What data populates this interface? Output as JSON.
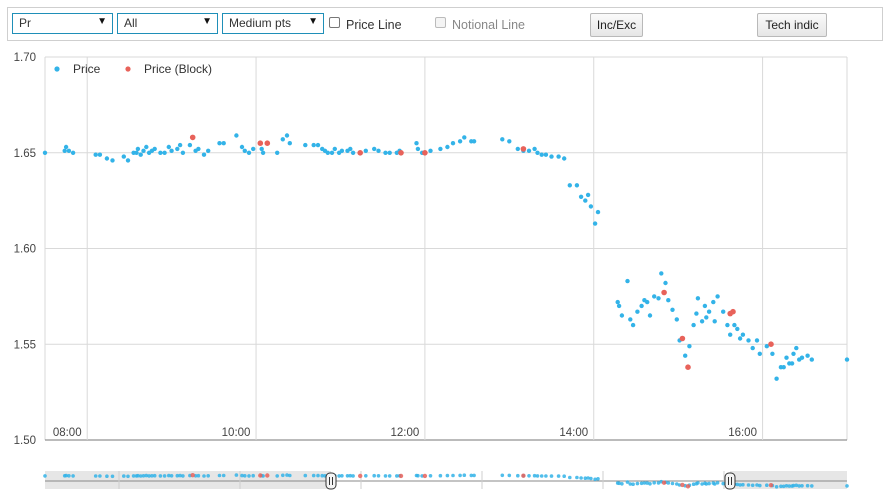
{
  "toolbar": {
    "field_select": "Pr",
    "filter_select": "All",
    "points_select": "Medium pts",
    "price_line_label": "Price Line",
    "notional_line_label": "Notional Line",
    "inc_exc_label": "Inc/Exc",
    "tech_indic_label": "Tech indic"
  },
  "colors": {
    "price": "#33b3e8",
    "block": "#e8625a",
    "grid": "#d9d9d9",
    "navigator_fill": "#e6e6e6"
  },
  "chart_data": {
    "type": "scatter",
    "x_unit": "time of day",
    "xlim": [
      "07:30",
      "17:00"
    ],
    "ylim": [
      1.5,
      1.7
    ],
    "x_ticks": [
      "08:00",
      "10:00",
      "12:00",
      "14:00",
      "16:00"
    ],
    "y_ticks": [
      "1.50",
      "1.55",
      "1.60",
      "1.65",
      "1.70"
    ],
    "grid": true,
    "legend_position": "top-left",
    "series": [
      {
        "name": "Price",
        "color": "#33b3e8",
        "points": [
          [
            "07:30",
            1.65
          ],
          [
            "07:44",
            1.651
          ],
          [
            "07:45",
            1.653
          ],
          [
            "07:47",
            1.651
          ],
          [
            "07:50",
            1.65
          ],
          [
            "08:06",
            1.649
          ],
          [
            "08:09",
            1.649
          ],
          [
            "08:14",
            1.647
          ],
          [
            "08:18",
            1.646
          ],
          [
            "08:26",
            1.648
          ],
          [
            "08:29",
            1.646
          ],
          [
            "08:33",
            1.65
          ],
          [
            "08:35",
            1.65
          ],
          [
            "08:36",
            1.652
          ],
          [
            "08:38",
            1.649
          ],
          [
            "08:40",
            1.651
          ],
          [
            "08:42",
            1.653
          ],
          [
            "08:44",
            1.65
          ],
          [
            "08:46",
            1.651
          ],
          [
            "08:48",
            1.652
          ],
          [
            "08:52",
            1.65
          ],
          [
            "08:55",
            1.65
          ],
          [
            "08:58",
            1.653
          ],
          [
            "09:00",
            1.651
          ],
          [
            "09:04",
            1.652
          ],
          [
            "09:06",
            1.654
          ],
          [
            "09:08",
            1.65
          ],
          [
            "09:13",
            1.654
          ],
          [
            "09:17",
            1.651
          ],
          [
            "09:19",
            1.652
          ],
          [
            "09:23",
            1.649
          ],
          [
            "09:26",
            1.651
          ],
          [
            "09:34",
            1.655
          ],
          [
            "09:37",
            1.655
          ],
          [
            "09:46",
            1.659
          ],
          [
            "09:50",
            1.653
          ],
          [
            "09:52",
            1.651
          ],
          [
            "09:55",
            1.65
          ],
          [
            "09:58",
            1.652
          ],
          [
            "10:04",
            1.652
          ],
          [
            "10:05",
            1.65
          ],
          [
            "10:15",
            1.65
          ],
          [
            "10:19",
            1.657
          ],
          [
            "10:22",
            1.659
          ],
          [
            "10:24",
            1.655
          ],
          [
            "10:35",
            1.654
          ],
          [
            "10:41",
            1.654
          ],
          [
            "10:44",
            1.654
          ],
          [
            "10:47",
            1.652
          ],
          [
            "10:49",
            1.651
          ],
          [
            "10:51",
            1.65
          ],
          [
            "10:54",
            1.65
          ],
          [
            "10:56",
            1.652
          ],
          [
            "10:59",
            1.65
          ],
          [
            "11:01",
            1.651
          ],
          [
            "11:05",
            1.651
          ],
          [
            "11:07",
            1.652
          ],
          [
            "11:09",
            1.65
          ],
          [
            "11:18",
            1.651
          ],
          [
            "11:24",
            1.652
          ],
          [
            "11:27",
            1.651
          ],
          [
            "11:32",
            1.65
          ],
          [
            "11:35",
            1.65
          ],
          [
            "11:40",
            1.65
          ],
          [
            "11:42",
            1.651
          ],
          [
            "11:54",
            1.655
          ],
          [
            "11:55",
            1.652
          ],
          [
            "11:58",
            1.65
          ],
          [
            "12:04",
            1.651
          ],
          [
            "12:11",
            1.652
          ],
          [
            "12:16",
            1.653
          ],
          [
            "12:20",
            1.655
          ],
          [
            "12:25",
            1.656
          ],
          [
            "12:28",
            1.658
          ],
          [
            "12:33",
            1.656
          ],
          [
            "12:35",
            1.656
          ],
          [
            "12:55",
            1.657
          ],
          [
            "13:00",
            1.656
          ],
          [
            "13:06",
            1.652
          ],
          [
            "13:10",
            1.651
          ],
          [
            "13:14",
            1.651
          ],
          [
            "13:18",
            1.652
          ],
          [
            "13:20",
            1.65
          ],
          [
            "13:23",
            1.649
          ],
          [
            "13:26",
            1.649
          ],
          [
            "13:30",
            1.648
          ],
          [
            "13:35",
            1.648
          ],
          [
            "13:39",
            1.647
          ],
          [
            "13:43",
            1.633
          ],
          [
            "13:48",
            1.633
          ],
          [
            "13:51",
            1.627
          ],
          [
            "13:54",
            1.625
          ],
          [
            "13:56",
            1.628
          ],
          [
            "13:58",
            1.622
          ],
          [
            "14:01",
            1.613
          ],
          [
            "14:03",
            1.619
          ],
          [
            "14:17",
            1.572
          ],
          [
            "14:18",
            1.57
          ],
          [
            "14:20",
            1.565
          ],
          [
            "14:24",
            1.583
          ],
          [
            "14:26",
            1.563
          ],
          [
            "14:28",
            1.56
          ],
          [
            "14:31",
            1.567
          ],
          [
            "14:34",
            1.57
          ],
          [
            "14:36",
            1.573
          ],
          [
            "14:38",
            1.572
          ],
          [
            "14:40",
            1.565
          ],
          [
            "14:43",
            1.575
          ],
          [
            "14:46",
            1.574
          ],
          [
            "14:48",
            1.587
          ],
          [
            "14:51",
            1.582
          ],
          [
            "14:53",
            1.573
          ],
          [
            "14:56",
            1.568
          ],
          [
            "14:59",
            1.563
          ],
          [
            "15:01",
            1.552
          ],
          [
            "15:05",
            1.544
          ],
          [
            "15:08",
            1.549
          ],
          [
            "15:11",
            1.56
          ],
          [
            "15:13",
            1.566
          ],
          [
            "15:14",
            1.574
          ],
          [
            "15:17",
            1.562
          ],
          [
            "15:19",
            1.57
          ],
          [
            "15:20",
            1.564
          ],
          [
            "15:22",
            1.567
          ],
          [
            "15:25",
            1.572
          ],
          [
            "15:26",
            1.562
          ],
          [
            "15:28",
            1.575
          ],
          [
            "15:32",
            1.567
          ],
          [
            "15:35",
            1.56
          ],
          [
            "15:37",
            1.555
          ],
          [
            "15:40",
            1.56
          ],
          [
            "15:42",
            1.558
          ],
          [
            "15:44",
            1.553
          ],
          [
            "15:46",
            1.555
          ],
          [
            "15:50",
            1.552
          ],
          [
            "15:53",
            1.548
          ],
          [
            "15:56",
            1.552
          ],
          [
            "15:58",
            1.545
          ],
          [
            "16:03",
            1.549
          ],
          [
            "16:07",
            1.545
          ],
          [
            "16:10",
            1.532
          ],
          [
            "16:13",
            1.538
          ],
          [
            "16:15",
            1.538
          ],
          [
            "16:17",
            1.543
          ],
          [
            "16:19",
            1.54
          ],
          [
            "16:21",
            1.54
          ],
          [
            "16:22",
            1.545
          ],
          [
            "16:24",
            1.548
          ],
          [
            "16:26",
            1.542
          ],
          [
            "16:28",
            1.543
          ],
          [
            "16:32",
            1.544
          ],
          [
            "16:35",
            1.542
          ],
          [
            "17:00",
            1.542
          ]
        ]
      },
      {
        "name": "Price (Block)",
        "color": "#e8625a",
        "points": [
          [
            "09:15",
            1.658
          ],
          [
            "10:03",
            1.655
          ],
          [
            "10:08",
            1.655
          ],
          [
            "11:14",
            1.65
          ],
          [
            "11:43",
            1.65
          ],
          [
            "12:00",
            1.65
          ],
          [
            "13:10",
            1.652
          ],
          [
            "14:50",
            1.577
          ],
          [
            "15:03",
            1.553
          ],
          [
            "15:07",
            1.538
          ],
          [
            "15:37",
            1.566
          ],
          [
            "15:39",
            1.567
          ],
          [
            "16:06",
            1.55
          ]
        ]
      }
    ]
  }
}
